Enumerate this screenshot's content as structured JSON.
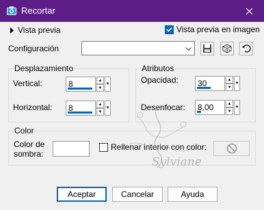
{
  "window": {
    "title": "Recortar",
    "icon": "camera-icon",
    "accent": "#5c1d86"
  },
  "preview": {
    "toggle_label": "Vista previa",
    "live_label": "Vista previa en imagen",
    "live_checked": true
  },
  "config": {
    "label": "Configuración",
    "value": ""
  },
  "offset": {
    "title": "Desplazamiento",
    "vertical_label": "Vertical:",
    "vertical_value": "8",
    "horizontal_label": "Horizontal:",
    "horizontal_value": "8"
  },
  "attributes": {
    "title": "Atributos",
    "opacity_label": "Opacidad:",
    "opacity_value": "30",
    "blur_label": "Desenfocar:",
    "blur_value": "8,00"
  },
  "color": {
    "title": "Color",
    "shadow_label_line1": "Color de",
    "shadow_label_line2": "sombra:",
    "fill_label": "Rellenar interior con color:",
    "fill_checked": false
  },
  "buttons": {
    "ok": "Aceptar",
    "cancel": "Cancelar",
    "help": "Ayuda"
  },
  "watermark": {
    "text": "Sylviane"
  }
}
